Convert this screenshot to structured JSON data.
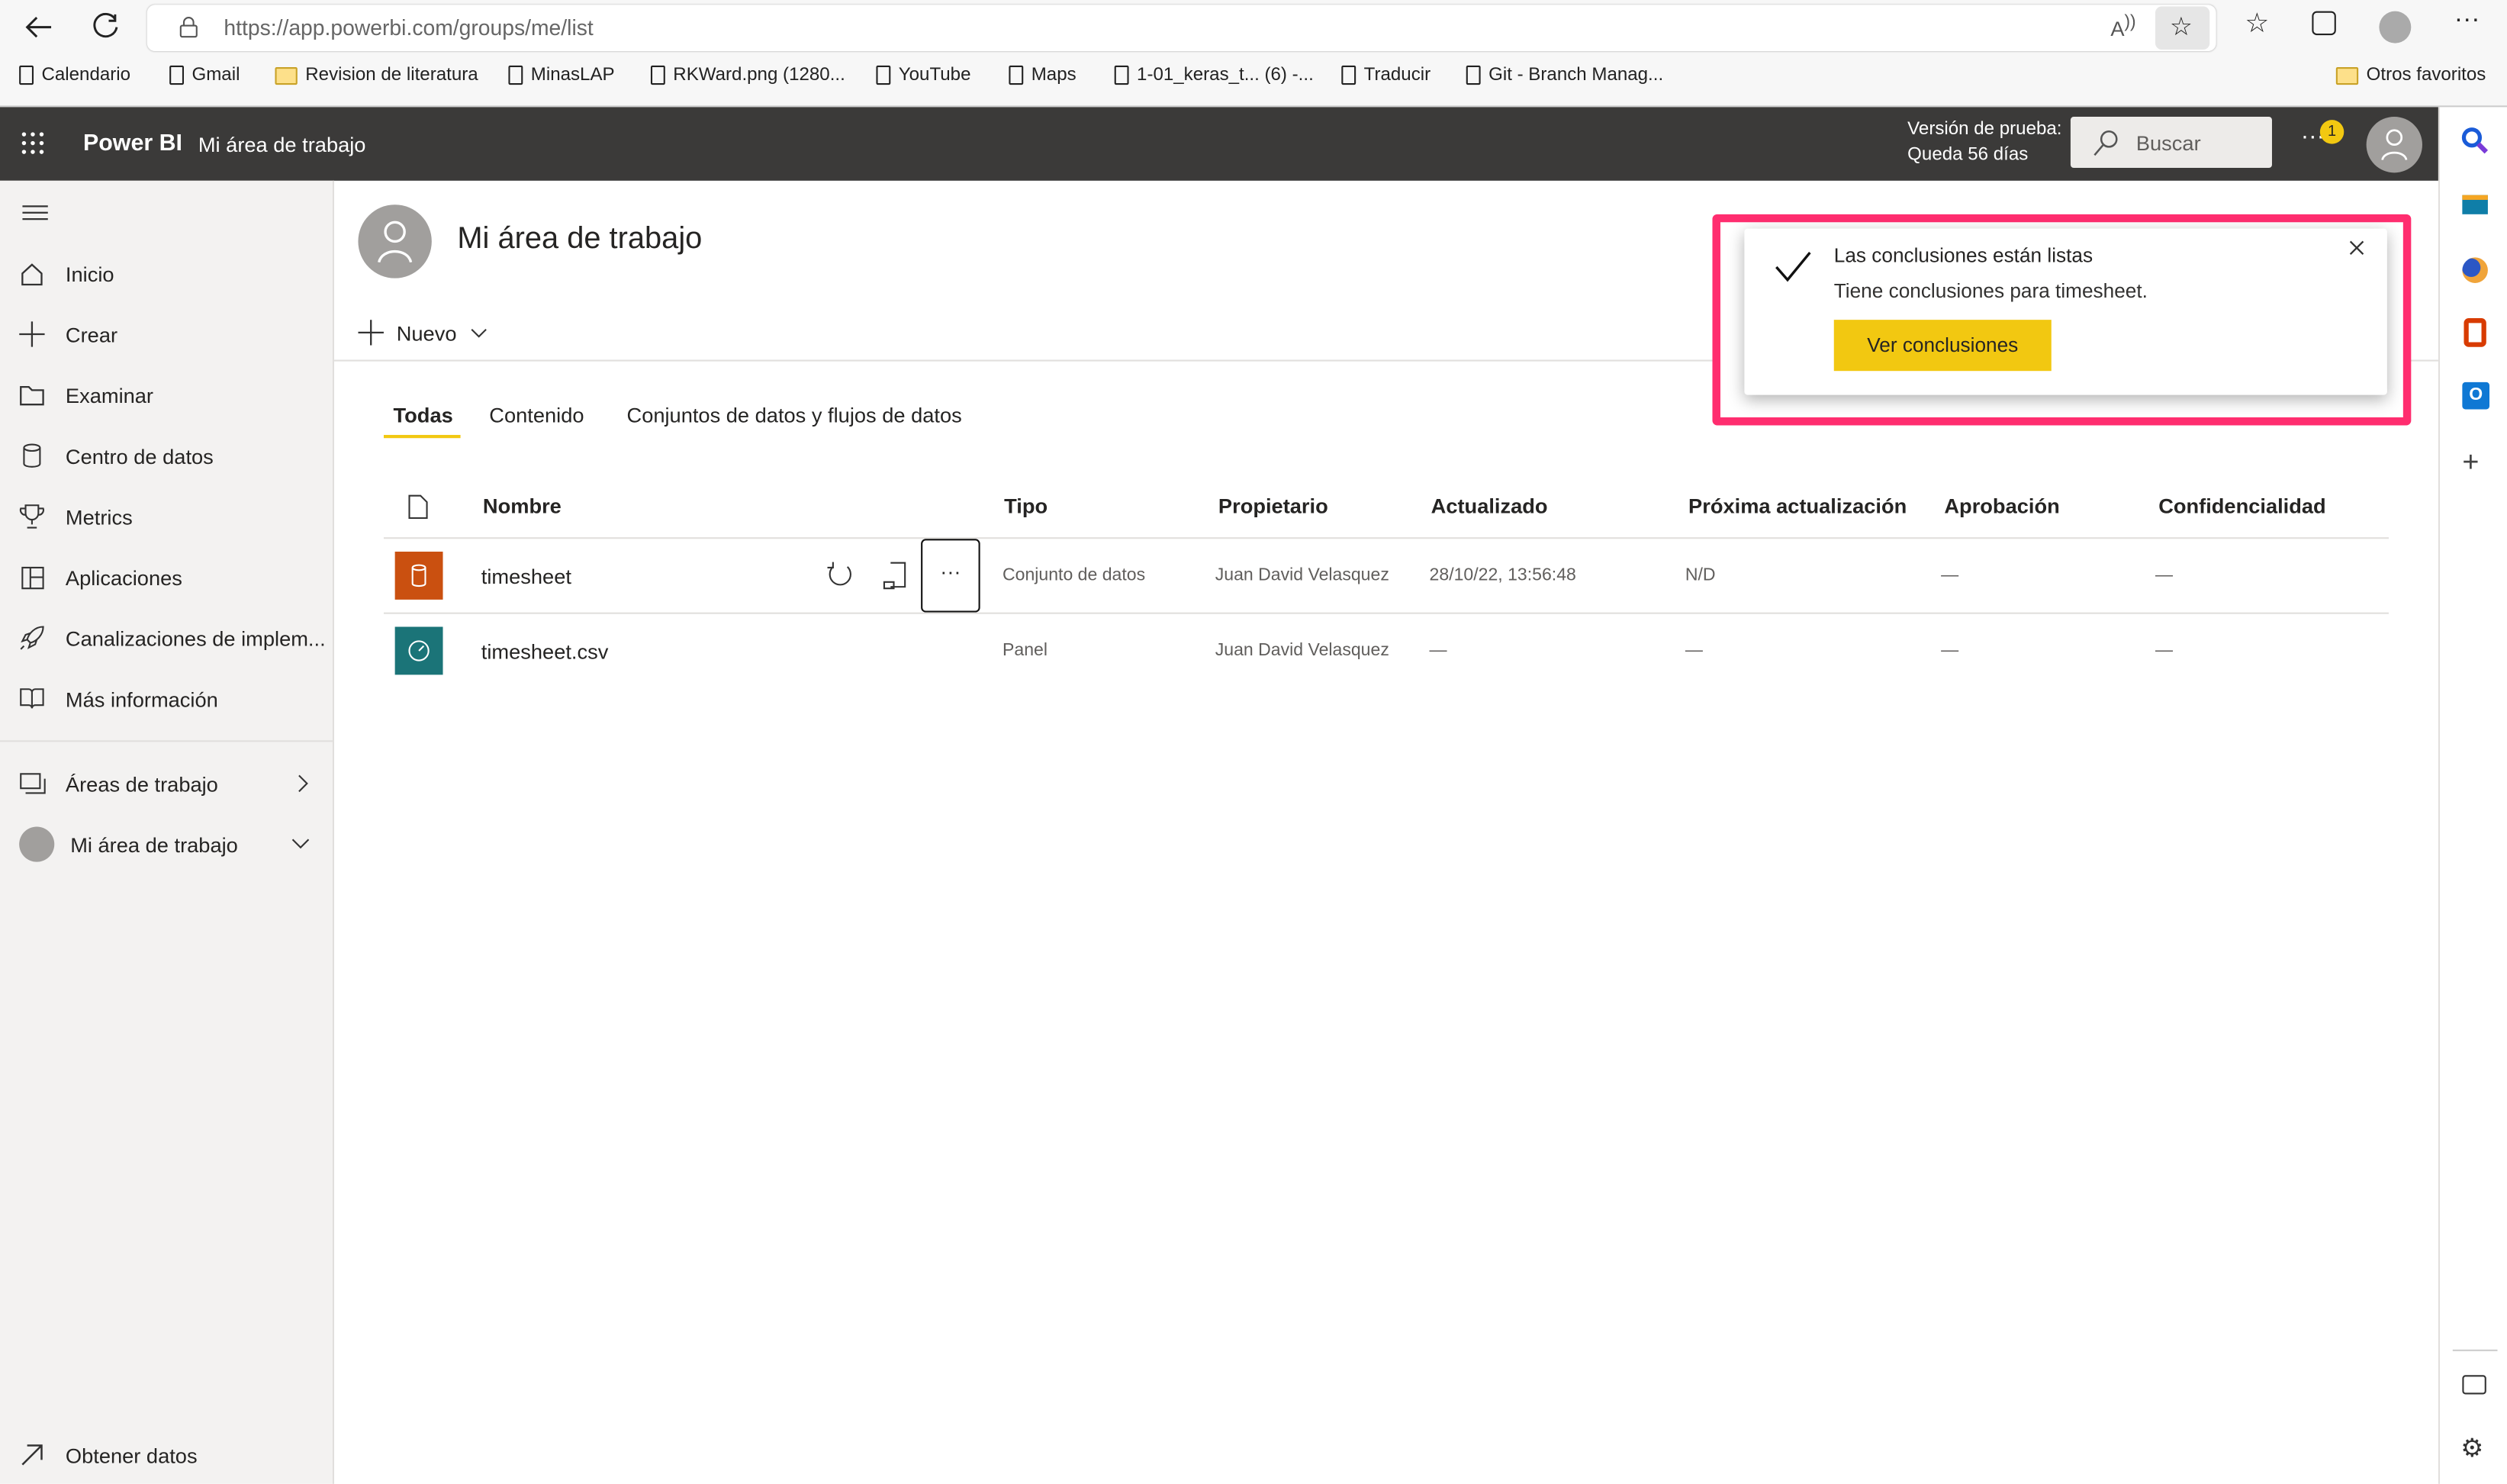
{
  "browser": {
    "url": "https://app.powerbi.com/groups/me/list",
    "bookmarks": [
      {
        "label": "Calendario",
        "icon": "page"
      },
      {
        "label": "Gmail",
        "icon": "page"
      },
      {
        "label": "Revision de literatura",
        "icon": "folder"
      },
      {
        "label": "MinasLAP",
        "icon": "page"
      },
      {
        "label": "RKWard.png (1280...",
        "icon": "page"
      },
      {
        "label": "YouTube",
        "icon": "page"
      },
      {
        "label": "Maps",
        "icon": "page"
      },
      {
        "label": "1-01_keras_t... (6) -...",
        "icon": "page"
      },
      {
        "label": "Traducir",
        "icon": "page"
      },
      {
        "label": "Git - Branch Manag...",
        "icon": "page"
      }
    ],
    "other_favorites": "Otros favoritos"
  },
  "header": {
    "app": "Power BI",
    "workspace": "Mi área de trabajo",
    "trial_line1": "Versión de prueba:",
    "trial_line2": "Queda 56 días",
    "search_placeholder": "Buscar",
    "notification_count": "1"
  },
  "sidebar": {
    "items": [
      {
        "label": "Inicio",
        "icon": "home"
      },
      {
        "label": "Crear",
        "icon": "plus"
      },
      {
        "label": "Examinar",
        "icon": "folder"
      },
      {
        "label": "Centro de datos",
        "icon": "database"
      },
      {
        "label": "Metrics",
        "icon": "trophy"
      },
      {
        "label": "Aplicaciones",
        "icon": "apps"
      },
      {
        "label": "Canalizaciones de implem...",
        "icon": "rocket"
      },
      {
        "label": "Más información",
        "icon": "book"
      }
    ],
    "workspaces": "Áreas de trabajo",
    "my_workspace": "Mi área de trabajo",
    "get_data": "Obtener datos"
  },
  "main": {
    "title": "Mi área de trabajo",
    "new_label": "Nuevo",
    "tabs": [
      {
        "label": "Todas",
        "active": true
      },
      {
        "label": "Contenido"
      },
      {
        "label": "Conjuntos de datos y flujos de datos"
      }
    ],
    "columns": [
      "Nombre",
      "Tipo",
      "Propietario",
      "Actualizado",
      "Próxima actualización",
      "Aprobación",
      "Confidencialidad"
    ],
    "rows": [
      {
        "name": "timesheet",
        "type": "Conjunto de datos",
        "owner": "Juan David Velasquez",
        "updated": "28/10/22, 13:56:48",
        "next": "N/D",
        "approval": "—",
        "sensitivity": "—",
        "icon": "dataset",
        "color": "#ca5010"
      },
      {
        "name": "timesheet.csv",
        "type": "Panel",
        "owner": "Juan David Velasquez",
        "updated": "—",
        "next": "—",
        "approval": "—",
        "sensitivity": "—",
        "icon": "dashboard",
        "color": "#1b7478"
      }
    ]
  },
  "toast": {
    "title": "Las conclusiones están listas",
    "body": "Tiene conclusiones para timesheet.",
    "button": "Ver conclusiones",
    "button_color": "#f2c811",
    "highlight_color": "#ff2d6f"
  }
}
